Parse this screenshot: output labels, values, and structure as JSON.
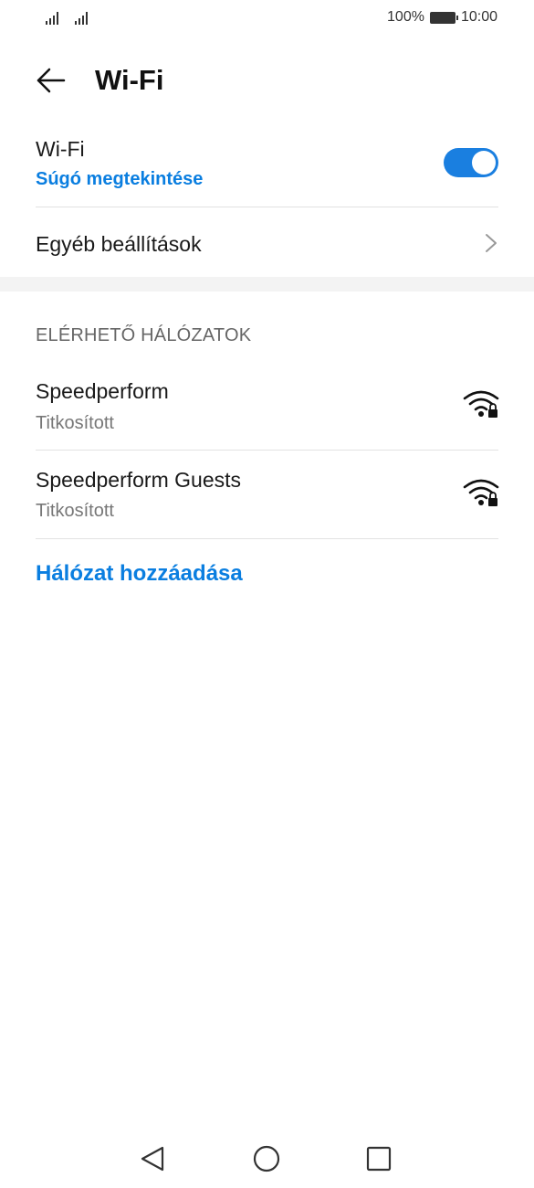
{
  "status_bar": {
    "battery_percent": "100%",
    "time": "10:00",
    "signal_icons": [
      "signal-icon",
      "signal-icon"
    ]
  },
  "header": {
    "back_icon": "arrow-left-icon",
    "title": "Wi-Fi"
  },
  "wifi_toggle_row": {
    "label": "Wi-Fi",
    "help_link": "Súgó megtekintése",
    "toggle_on": true,
    "accent_color": "#1a7fe0"
  },
  "other_settings": {
    "label": "Egyéb beállítások",
    "icon": "chevron-right-icon"
  },
  "networks_section": {
    "header": "ELÉRHETŐ HÁLÓZATOK",
    "networks": [
      {
        "name": "Speedperform",
        "status": "Titkosított",
        "icon": "wifi-lock-icon"
      },
      {
        "name": "Speedperform Guests",
        "status": "Titkosított",
        "icon": "wifi-lock-icon"
      }
    ],
    "add_network": "Hálózat hozzáadása"
  },
  "nav_bar": {
    "buttons": [
      "back-triangle-icon",
      "home-circle-icon",
      "recents-square-icon"
    ]
  }
}
